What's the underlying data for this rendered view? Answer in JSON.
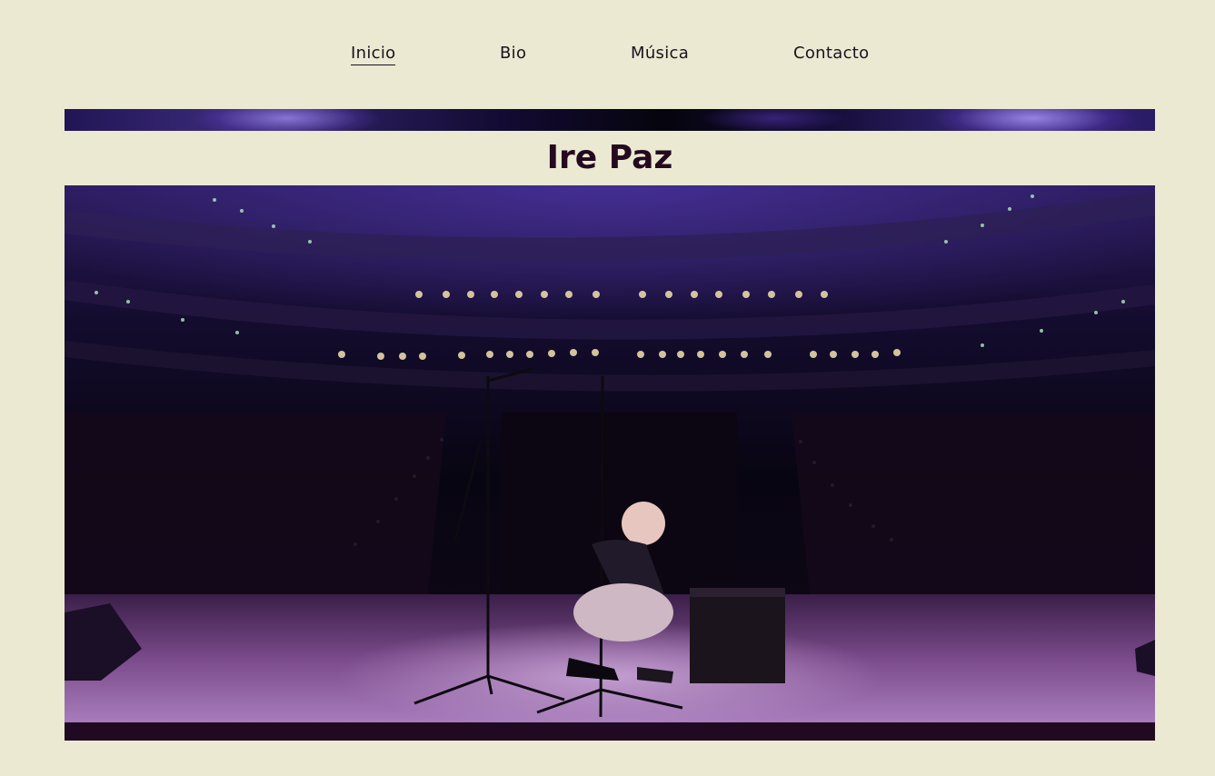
{
  "nav": {
    "items": [
      {
        "label": "Inicio",
        "active": true
      },
      {
        "label": "Bio",
        "active": false
      },
      {
        "label": "Música",
        "active": false
      },
      {
        "label": "Contacto",
        "active": false
      }
    ]
  },
  "page": {
    "title": "Ire Paz"
  },
  "colors": {
    "background": "#ebe9d2",
    "text": "#24091f",
    "accent_purple": "#3b2a82",
    "footer_bar": "#1f0a22"
  }
}
